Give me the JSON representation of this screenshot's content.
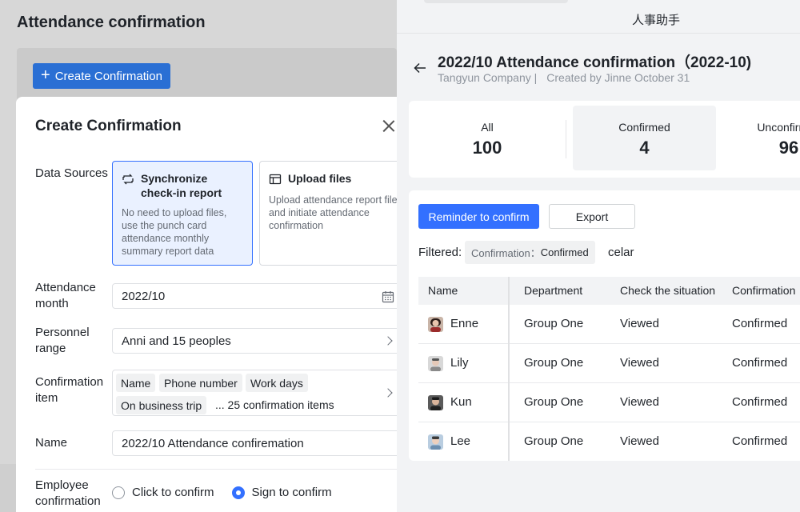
{
  "background_page": {
    "title": "Attendance confirmation",
    "create_button_label": "Create Confirmation"
  },
  "modal": {
    "title": "Create Confirmation",
    "data_sources": {
      "label": "Data Sources",
      "options": [
        {
          "title": "Synchronize check-in report",
          "description": "No need to upload files, use the punch card attendance monthly summary report data",
          "selected": true,
          "icon": "sync-icon"
        },
        {
          "title": "Upload files",
          "description": "Upload attendance report file and initiate attendance confirmation",
          "selected": false,
          "icon": "table-icon"
        }
      ]
    },
    "attendance_month": {
      "label": "Attendance month",
      "value": "2022/10"
    },
    "personnel_range": {
      "label": "Personnel range",
      "value": "Anni and 15 peoples"
    },
    "confirmation_item": {
      "label": "Confirmation item",
      "tags": [
        "Name",
        "Phone number",
        "Work days",
        "On business trip"
      ],
      "more": "... 25 confirmation items"
    },
    "name": {
      "label": "Name",
      "value": "2022/10 Attendance confiremation"
    },
    "employee_confirmation": {
      "label": "Employee confirmation",
      "options": [
        {
          "label": "Click to confirm",
          "checked": false
        },
        {
          "label": "Sign to confirm",
          "checked": true
        }
      ]
    }
  },
  "detail": {
    "app_name": "人事助手",
    "title": "2022/10 Attendance confirmation（2022-10)",
    "company": "Tangyun Company |",
    "creator": "Created by Jinne October 31",
    "stats": [
      {
        "label": "All",
        "value": "100"
      },
      {
        "label": "Confirmed",
        "value": "4"
      },
      {
        "label": "Unconfirmed",
        "value": "96"
      }
    ],
    "buttons": {
      "remind": "Reminder to confirm",
      "export": "Export"
    },
    "filter": {
      "label": "Filtered:",
      "chip_key": "Confirmation：",
      "chip_value": "Confirmed",
      "clear": "celar"
    },
    "table": {
      "columns": [
        "Name",
        "Department",
        "Check the situation",
        "Confirmation"
      ],
      "rows": [
        {
          "name": "Enne",
          "department": "Group One",
          "check": "Viewed",
          "confirmation": "Confirmed"
        },
        {
          "name": "Lily",
          "department": "Group One",
          "check": "Viewed",
          "confirmation": "Confirmed"
        },
        {
          "name": "Kun",
          "department": "Group One",
          "check": "Viewed",
          "confirmation": "Confirmed"
        },
        {
          "name": "Lee",
          "department": "Group One",
          "check": "Viewed",
          "confirmation": "Confirmed"
        }
      ]
    }
  },
  "colors": {
    "primary": "#3370ff",
    "selected_card_bg": "#eaf1ff",
    "overlay": "#d7d7d7"
  }
}
